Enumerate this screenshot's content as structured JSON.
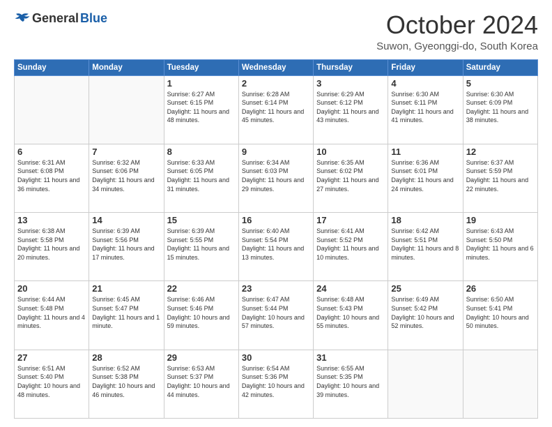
{
  "header": {
    "logo_general": "General",
    "logo_blue": "Blue",
    "month_title": "October 2024",
    "location": "Suwon, Gyeonggi-do, South Korea"
  },
  "days_of_week": [
    "Sunday",
    "Monday",
    "Tuesday",
    "Wednesday",
    "Thursday",
    "Friday",
    "Saturday"
  ],
  "weeks": [
    [
      {
        "day": "",
        "info": ""
      },
      {
        "day": "",
        "info": ""
      },
      {
        "day": "1",
        "info": "Sunrise: 6:27 AM\nSunset: 6:15 PM\nDaylight: 11 hours and 48 minutes."
      },
      {
        "day": "2",
        "info": "Sunrise: 6:28 AM\nSunset: 6:14 PM\nDaylight: 11 hours and 45 minutes."
      },
      {
        "day": "3",
        "info": "Sunrise: 6:29 AM\nSunset: 6:12 PM\nDaylight: 11 hours and 43 minutes."
      },
      {
        "day": "4",
        "info": "Sunrise: 6:30 AM\nSunset: 6:11 PM\nDaylight: 11 hours and 41 minutes."
      },
      {
        "day": "5",
        "info": "Sunrise: 6:30 AM\nSunset: 6:09 PM\nDaylight: 11 hours and 38 minutes."
      }
    ],
    [
      {
        "day": "6",
        "info": "Sunrise: 6:31 AM\nSunset: 6:08 PM\nDaylight: 11 hours and 36 minutes."
      },
      {
        "day": "7",
        "info": "Sunrise: 6:32 AM\nSunset: 6:06 PM\nDaylight: 11 hours and 34 minutes."
      },
      {
        "day": "8",
        "info": "Sunrise: 6:33 AM\nSunset: 6:05 PM\nDaylight: 11 hours and 31 minutes."
      },
      {
        "day": "9",
        "info": "Sunrise: 6:34 AM\nSunset: 6:03 PM\nDaylight: 11 hours and 29 minutes."
      },
      {
        "day": "10",
        "info": "Sunrise: 6:35 AM\nSunset: 6:02 PM\nDaylight: 11 hours and 27 minutes."
      },
      {
        "day": "11",
        "info": "Sunrise: 6:36 AM\nSunset: 6:01 PM\nDaylight: 11 hours and 24 minutes."
      },
      {
        "day": "12",
        "info": "Sunrise: 6:37 AM\nSunset: 5:59 PM\nDaylight: 11 hours and 22 minutes."
      }
    ],
    [
      {
        "day": "13",
        "info": "Sunrise: 6:38 AM\nSunset: 5:58 PM\nDaylight: 11 hours and 20 minutes."
      },
      {
        "day": "14",
        "info": "Sunrise: 6:39 AM\nSunset: 5:56 PM\nDaylight: 11 hours and 17 minutes."
      },
      {
        "day": "15",
        "info": "Sunrise: 6:39 AM\nSunset: 5:55 PM\nDaylight: 11 hours and 15 minutes."
      },
      {
        "day": "16",
        "info": "Sunrise: 6:40 AM\nSunset: 5:54 PM\nDaylight: 11 hours and 13 minutes."
      },
      {
        "day": "17",
        "info": "Sunrise: 6:41 AM\nSunset: 5:52 PM\nDaylight: 11 hours and 10 minutes."
      },
      {
        "day": "18",
        "info": "Sunrise: 6:42 AM\nSunset: 5:51 PM\nDaylight: 11 hours and 8 minutes."
      },
      {
        "day": "19",
        "info": "Sunrise: 6:43 AM\nSunset: 5:50 PM\nDaylight: 11 hours and 6 minutes."
      }
    ],
    [
      {
        "day": "20",
        "info": "Sunrise: 6:44 AM\nSunset: 5:48 PM\nDaylight: 11 hours and 4 minutes."
      },
      {
        "day": "21",
        "info": "Sunrise: 6:45 AM\nSunset: 5:47 PM\nDaylight: 11 hours and 1 minute."
      },
      {
        "day": "22",
        "info": "Sunrise: 6:46 AM\nSunset: 5:46 PM\nDaylight: 10 hours and 59 minutes."
      },
      {
        "day": "23",
        "info": "Sunrise: 6:47 AM\nSunset: 5:44 PM\nDaylight: 10 hours and 57 minutes."
      },
      {
        "day": "24",
        "info": "Sunrise: 6:48 AM\nSunset: 5:43 PM\nDaylight: 10 hours and 55 minutes."
      },
      {
        "day": "25",
        "info": "Sunrise: 6:49 AM\nSunset: 5:42 PM\nDaylight: 10 hours and 52 minutes."
      },
      {
        "day": "26",
        "info": "Sunrise: 6:50 AM\nSunset: 5:41 PM\nDaylight: 10 hours and 50 minutes."
      }
    ],
    [
      {
        "day": "27",
        "info": "Sunrise: 6:51 AM\nSunset: 5:40 PM\nDaylight: 10 hours and 48 minutes."
      },
      {
        "day": "28",
        "info": "Sunrise: 6:52 AM\nSunset: 5:38 PM\nDaylight: 10 hours and 46 minutes."
      },
      {
        "day": "29",
        "info": "Sunrise: 6:53 AM\nSunset: 5:37 PM\nDaylight: 10 hours and 44 minutes."
      },
      {
        "day": "30",
        "info": "Sunrise: 6:54 AM\nSunset: 5:36 PM\nDaylight: 10 hours and 42 minutes."
      },
      {
        "day": "31",
        "info": "Sunrise: 6:55 AM\nSunset: 5:35 PM\nDaylight: 10 hours and 39 minutes."
      },
      {
        "day": "",
        "info": ""
      },
      {
        "day": "",
        "info": ""
      }
    ]
  ]
}
